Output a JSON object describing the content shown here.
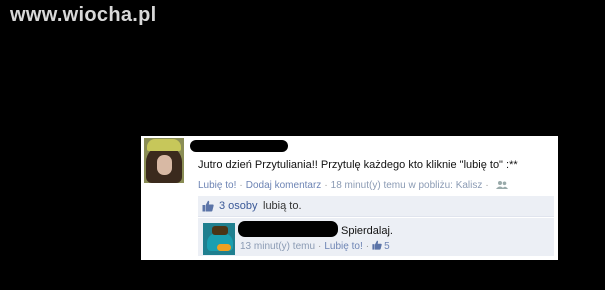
{
  "watermark": "www.wiocha.pl",
  "post": {
    "text": "Jutro dzień Przytuliania!! Przytulę każdego kto kliknie \"lubię to\" :**",
    "like_link": "Lubię to!",
    "comment_link": "Dodaj komentarz",
    "time_location": "18 minut(y) temu w pobliżu: Kalisz",
    "icons": {
      "audience": "people-icon"
    }
  },
  "likes": {
    "count_link": "3 osoby",
    "suffix": "lubią to.",
    "icon": "thumbs-up-icon"
  },
  "comment": {
    "text": "Spierdalaj.",
    "time": "13 minut(y) temu",
    "like_link": "Lubię to!",
    "like_count": "5",
    "icon": "thumbs-up-icon"
  },
  "colors": {
    "link": "#6d84b4",
    "brand_blue": "#3b5998",
    "panel": "#eceff5",
    "background": "#000000"
  }
}
